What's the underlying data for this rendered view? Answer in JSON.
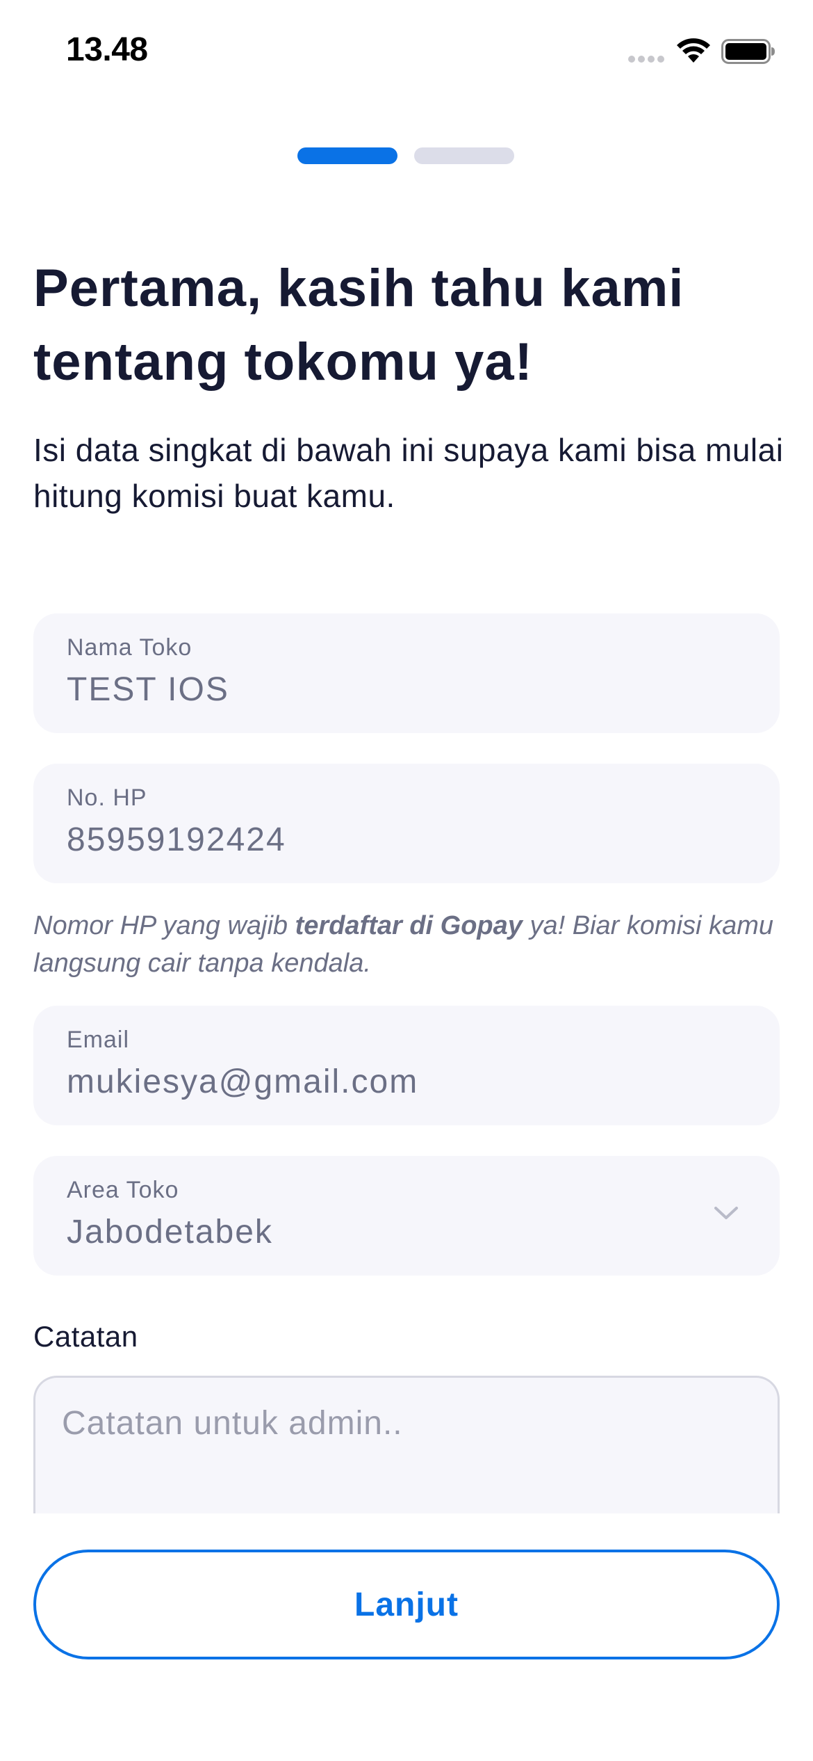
{
  "status_bar": {
    "time": "13.48",
    "signal_icon": "signal-icon",
    "wifi_icon": "wifi-icon",
    "battery_icon": "battery-icon"
  },
  "progress": {
    "current_step": 1,
    "total_steps": 2,
    "active_color": "#0a72e6",
    "inactive_color": "#dcdde9"
  },
  "header": {
    "title": "Pertama, kasih tahu kami tentang tokomu ya!",
    "subtitle": "Isi data singkat di bawah ini supaya kami bisa mulai hitung komisi buat kamu."
  },
  "form": {
    "store_name": {
      "label": "Nama Toko",
      "value": "TEST IOS"
    },
    "phone": {
      "label": "No. HP",
      "value": "85959192424"
    },
    "phone_helper": {
      "before": "Nomor HP yang wajib ",
      "bold": "terdaftar di Gopay",
      "after": " ya! Biar komisi kamu langsung cair tanpa kendala."
    },
    "email": {
      "label": "Email",
      "value": "mukiesya@gmail.com"
    },
    "area": {
      "label": "Area Toko",
      "value": "Jabodetabek",
      "icon": "chevron-down-icon"
    },
    "notes": {
      "label": "Catatan",
      "placeholder": "Catatan untuk admin.."
    }
  },
  "actions": {
    "next_label": "Lanjut",
    "accent_color": "#0a72e6"
  }
}
